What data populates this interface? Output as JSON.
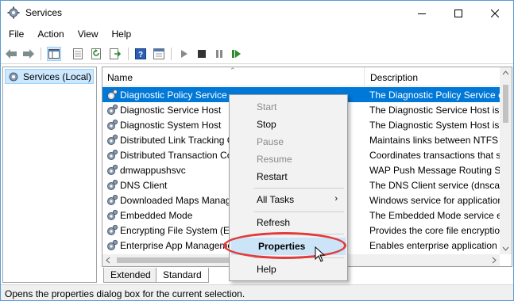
{
  "window": {
    "title": "Services"
  },
  "menu": [
    "File",
    "Action",
    "View",
    "Help"
  ],
  "toolbar": {
    "icons": [
      "back-arrow-icon",
      "forward-arrow-icon",
      "show-hide-console-tree-icon",
      "export-list-icon",
      "refresh-icon",
      "export-icon",
      "help-icon",
      "properties-icon",
      "start-service-icon",
      "stop-service-icon",
      "pause-service-icon",
      "restart-service-icon"
    ]
  },
  "tree": {
    "root_label": "Services (Local)"
  },
  "list": {
    "columns": {
      "name": "Name",
      "description": "Description"
    },
    "rows": [
      {
        "name": "Diagnostic Policy Service",
        "description": "The Diagnostic Policy Service e"
      },
      {
        "name": "Diagnostic Service Host",
        "description": "The Diagnostic Service Host is u"
      },
      {
        "name": "Diagnostic System Host",
        "description": "The Diagnostic System Host is"
      },
      {
        "name": "Distributed Link Tracking C",
        "description": "Maintains links between NTFS f"
      },
      {
        "name": "Distributed Transaction Co",
        "description": "Coordinates transactions that s"
      },
      {
        "name": "dmwappushsvc",
        "description": "WAP Push Message Routing Se"
      },
      {
        "name": "DNS Client",
        "description": "The DNS Client service (dnscac"
      },
      {
        "name": "Downloaded Maps Manag",
        "description": "Windows service for application"
      },
      {
        "name": "Embedded Mode",
        "description": "The Embedded Mode service e"
      },
      {
        "name": "Encrypting File System (EF",
        "description": "Provides the core file encryptio"
      },
      {
        "name": "Enterprise App Manageme",
        "description": "Enables enterprise application m"
      }
    ]
  },
  "tabs": [
    "Extended",
    "Standard"
  ],
  "status": "Opens the properties dialog box for the current selection.",
  "context_menu": {
    "start": "Start",
    "stop": "Stop",
    "pause": "Pause",
    "resume": "Resume",
    "restart": "Restart",
    "all_tasks": "All Tasks",
    "refresh": "Refresh",
    "properties": "Properties",
    "help": "Help"
  },
  "colors": {
    "selection": "#0078d7",
    "highlight_oval": "#e23b3b",
    "menu_highlight": "#cce4f7"
  }
}
